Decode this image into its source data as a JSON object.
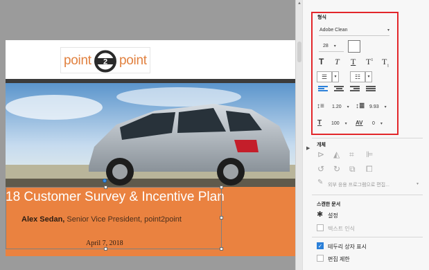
{
  "slide": {
    "logo_left": "point",
    "logo_num": "2",
    "logo_right": "point",
    "title": "18 Customer Survey & Incentive Plan",
    "presenter_name": "Alex Sedan,",
    "presenter_role": " Senior Vice President, point2point",
    "date": "April 7, 2018"
  },
  "panel": {
    "format_title": "형식",
    "font_family": "Adobe Clean",
    "font_size": "28",
    "text_styles": [
      "T",
      "T",
      "T",
      "T",
      "T"
    ],
    "line_spacing": "1.20",
    "para_spacing": "9.93",
    "h_scale": "100",
    "char_spacing": "0",
    "char_spacing_icon": "AV",
    "objects_title": "개체",
    "edit_external_label": "외부 응용 프로그램으로 편집...",
    "scanned_title": "스캔한 문서",
    "settings_label": "설정",
    "recognize_text_label": "텍스트 인식",
    "show_bbox_label": "테두리 상자 표시",
    "restrict_edit_label": "편집 제한",
    "accent_color": "#2b80d9",
    "highlight_color": "#e2262a"
  }
}
